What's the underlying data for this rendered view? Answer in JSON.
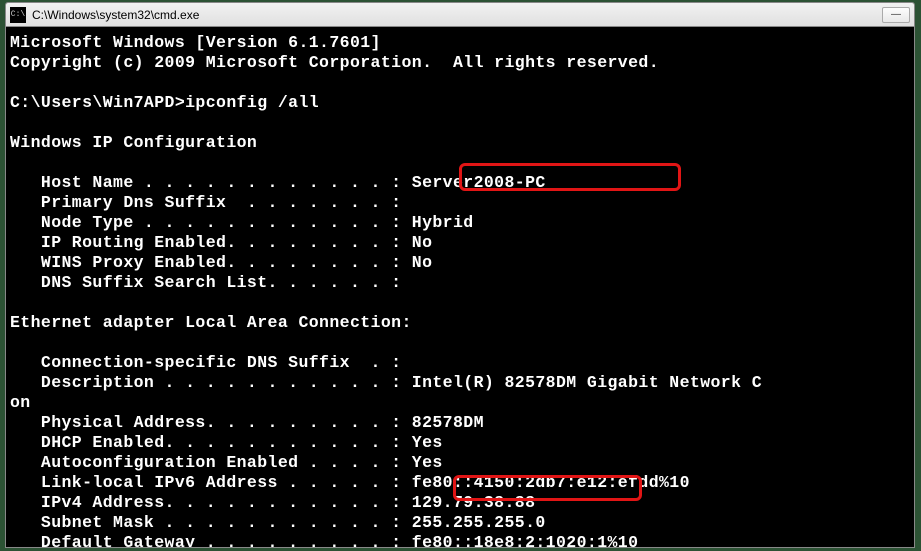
{
  "titlebar": {
    "icon_label": "C:\\",
    "title": "C:\\Windows\\system32\\cmd.exe",
    "minimize": "—"
  },
  "terminal_text": "Microsoft Windows [Version 6.1.7601]\nCopyright (c) 2009 Microsoft Corporation.  All rights reserved.\n\nC:\\Users\\Win7APD>ipconfig /all\n\nWindows IP Configuration\n\n   Host Name . . . . . . . . . . . . : Server2008-PC\n   Primary Dns Suffix  . . . . . . . :\n   Node Type . . . . . . . . . . . . : Hybrid\n   IP Routing Enabled. . . . . . . . : No\n   WINS Proxy Enabled. . . . . . . . : No\n   DNS Suffix Search List. . . . . . :\n\nEthernet adapter Local Area Connection:\n\n   Connection-specific DNS Suffix  . :\n   Description . . . . . . . . . . . : Intel(R) 82578DM Gigabit Network C\non\n   Physical Address. . . . . . . . . : 82578DM\n   DHCP Enabled. . . . . . . . . . . : Yes\n   Autoconfiguration Enabled . . . . : Yes\n   Link-local IPv6 Address . . . . . : fe80::4150:2db7:e12:efdd%10\n   IPv4 Address. . . . . . . . . . . : 129.79.38.88\n   Subnet Mask . . . . . . . . . . . : 255.255.255.0\n   Default Gateway . . . . . . . . . : fe80::18e8:2:1020:1%10"
}
